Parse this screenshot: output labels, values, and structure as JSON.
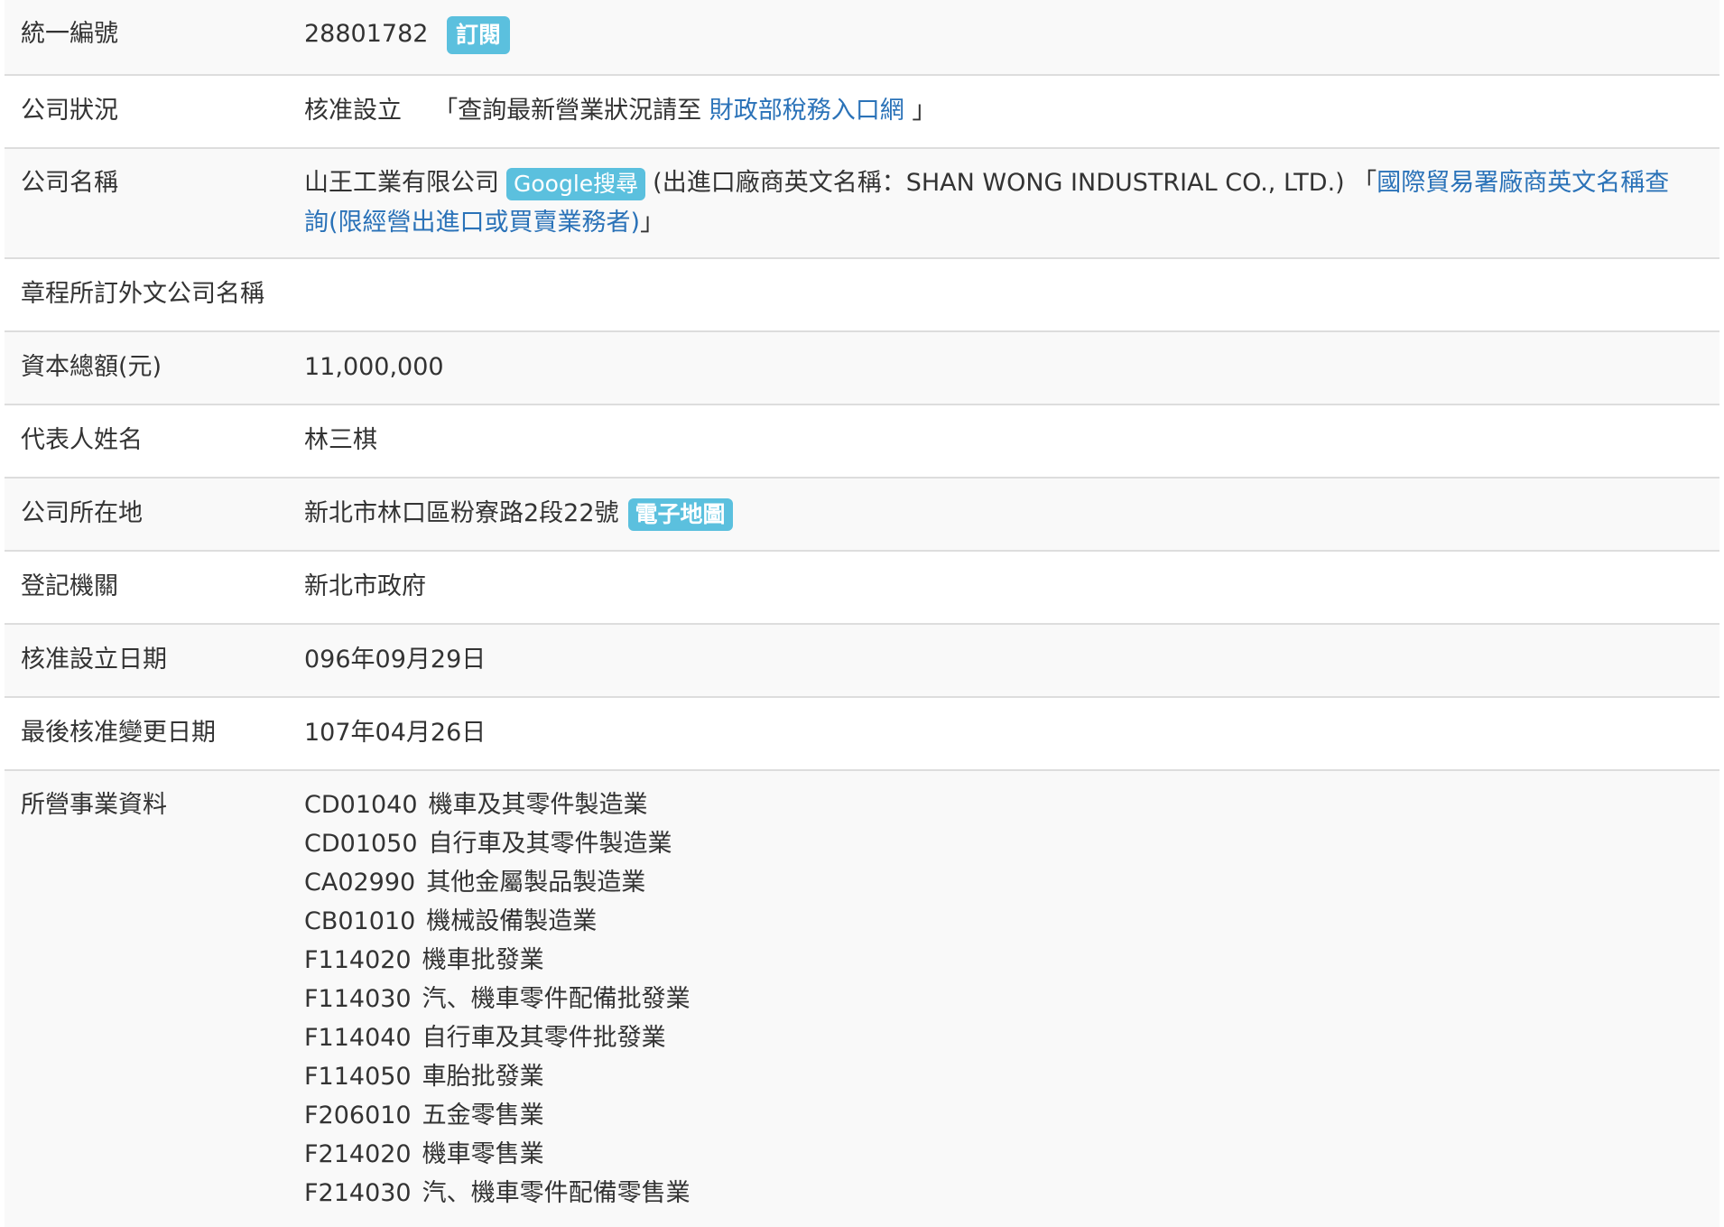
{
  "rows": {
    "uniform_no": {
      "label": "統一編號",
      "value": "28801782",
      "badge": "訂閱"
    },
    "status": {
      "label": "公司狀況",
      "value": "核准設立",
      "note_open": "「查詢最新營業狀況請至",
      "link": "財政部稅務入口網",
      "note_close": "」"
    },
    "name": {
      "label": "公司名稱",
      "value": "山王工業有限公司",
      "badge": "Google搜尋",
      "english": "(出進口廠商英文名稱：SHAN WONG INDUSTRIAL CO., LTD.)",
      "link_open": "「",
      "link": "國際貿易署廠商英文名稱查詢(限經營出進口或買賣業務者)",
      "link_close": "」"
    },
    "foreign_name": {
      "label": "章程所訂外文公司名稱",
      "value": ""
    },
    "capital": {
      "label": "資本總額(元)",
      "value": "11,000,000"
    },
    "representative": {
      "label": "代表人姓名",
      "value": "林三棋"
    },
    "address": {
      "label": "公司所在地",
      "value": "新北市林口區粉寮路2段22號",
      "badge": "電子地圖"
    },
    "authority": {
      "label": "登記機關",
      "value": "新北市政府"
    },
    "established": {
      "label": "核准設立日期",
      "value": "096年09月29日"
    },
    "last_change": {
      "label": "最後核准變更日期",
      "value": "107年04月26日"
    },
    "business": {
      "label": "所營事業資料",
      "items": [
        {
          "code": "CD01040",
          "name": "機車及其零件製造業"
        },
        {
          "code": "CD01050",
          "name": "自行車及其零件製造業"
        },
        {
          "code": "CA02990",
          "name": "其他金屬製品製造業"
        },
        {
          "code": "CB01010",
          "name": "機械設備製造業"
        },
        {
          "code": "F114020",
          "name": "機車批發業"
        },
        {
          "code": "F114030",
          "name": "汽、機車零件配備批發業"
        },
        {
          "code": "F114040",
          "name": "自行車及其零件批發業"
        },
        {
          "code": "F114050",
          "name": "車胎批發業"
        },
        {
          "code": "F206010",
          "name": "五金零售業"
        },
        {
          "code": "F214020",
          "name": "機車零售業"
        },
        {
          "code": "F214030",
          "name": "汽、機車零件配備零售業"
        }
      ]
    }
  },
  "colors": {
    "badge": "#5bc0de",
    "link": "#2a72b8",
    "stripe": "#f9f9f9",
    "border": "#dddddd"
  }
}
